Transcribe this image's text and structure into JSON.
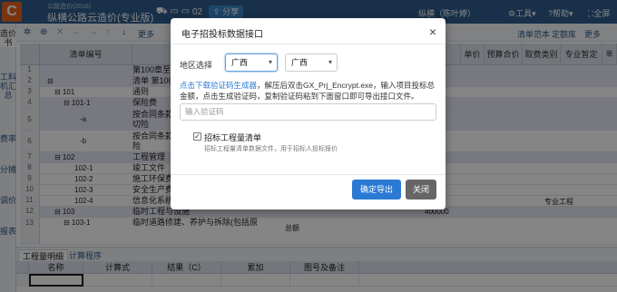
{
  "titlebar": {
    "logo_letter": "C",
    "app_subtitle": "公路造价(2018)",
    "app_title": "纵横公路云造价(专业版)",
    "file_icons": "⛟ ▭ ▭",
    "file_code": "02",
    "share_label": "分享",
    "user": "纵横（陈叶婷）",
    "tools_label": "工具",
    "help_label": "帮助",
    "fullscreen_label": "全屏"
  },
  "leftbar": {
    "tabs": [
      "造价书",
      "工料机汇总",
      "费率",
      "分摊",
      "调价",
      "报表"
    ]
  },
  "toolbar": {
    "more_label": "更多",
    "right_links": [
      "清单范本",
      "定额库",
      "更多"
    ]
  },
  "grid": {
    "headers": {
      "code": "清单编号",
      "unit_price": "单价",
      "budget_total": "预算合价",
      "fee_category": "取费类别",
      "specialty_provisional": "专业暂定",
      "last": "单分"
    },
    "rows": [
      {
        "no": "1",
        "code": "",
        "name": "第100章至7",
        "extra": "",
        "alt": true
      },
      {
        "no": "2",
        "code": "⊟",
        "name": "清单 第100",
        "extra": "",
        "alt": true
      },
      {
        "no": "3",
        "code": "⊟ 101",
        "name": "通则",
        "extra": "",
        "alt": false
      },
      {
        "no": "4",
        "code": "⊟ 101-1",
        "name": "保险费",
        "extra": "",
        "alt": true
      },
      {
        "no": "5",
        "code": "-a",
        "name": "按合同条款\n切险",
        "extra": "",
        "alt": true
      },
      {
        "no": "6",
        "code": "-b",
        "name": "按合同条款\n险",
        "extra": "",
        "alt": false
      },
      {
        "no": "7",
        "code": "⊟ 102",
        "name": "工程管理",
        "extra": "",
        "alt": true
      },
      {
        "no": "8",
        "code": "102-1",
        "name": "竣工文件",
        "extra": "",
        "alt": false
      },
      {
        "no": "9",
        "code": "102-2",
        "name": "施工环保费",
        "extra": "",
        "alt": false
      },
      {
        "no": "10",
        "code": "102-3",
        "name": "安全生产费",
        "extra": "",
        "alt": false
      },
      {
        "no": "11",
        "code": "102-4",
        "name": "信息化系统",
        "extra": "专业工程",
        "alt": false
      },
      {
        "no": "12",
        "code": "⊟ 103",
        "name": "临时工程与设施",
        "extra": "400000",
        "alt": true
      },
      {
        "no": "13",
        "code": "⊟ 103-1",
        "name": "临时道路修建、养护与拆除(包括原",
        "extra": "总额",
        "alt": false
      }
    ]
  },
  "bottom": {
    "tabs": [
      "工程量明细",
      "计算程序"
    ],
    "headers": [
      "名称",
      "计算式",
      "结果（C）",
      "累加",
      "图号及备注"
    ]
  },
  "dialog": {
    "title": "电子招投标数据接口",
    "close_icon": "×",
    "region_label": "地区选择",
    "region_1": "广西",
    "region_2": "广西",
    "desc_link": "点击下载验证码生成器",
    "desc_rest": "，解压后双击GX_Prj_Encrypt.exe，输入项目投标总金额，点击生成验证码，复制验证码粘到下面窗口即可导出接口文件。",
    "code_placeholder": "输入验证码",
    "checkbox_mark": "✓",
    "checkbox_label": "招标工程量清单",
    "checkbox_hint": "招标工程量清单数据文件，用于招标人投标报价",
    "ok_label": "确定导出",
    "cancel_label": "关闭"
  }
}
